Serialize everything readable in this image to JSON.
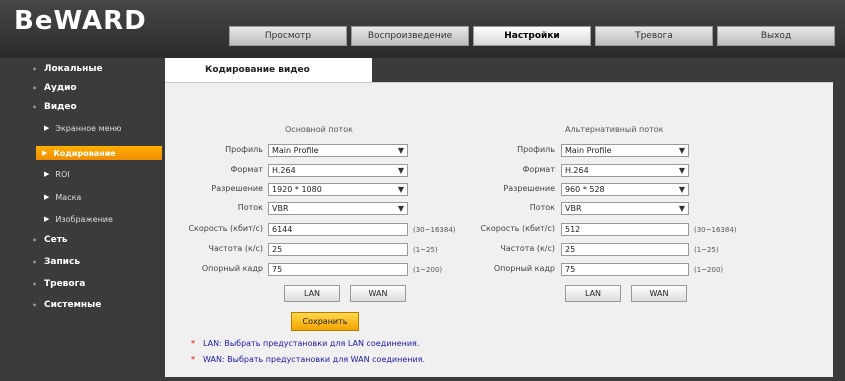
{
  "brand": {
    "logo": "BeWARD"
  },
  "topnav": [
    "Просмотр",
    "Воспроизведение",
    "Настройки",
    "Тревога",
    "Выход"
  ],
  "sidebar": {
    "items": [
      "Локальные",
      "Аудио",
      "Видео",
      "Сеть",
      "Запись",
      "Тревога",
      "Системные"
    ],
    "video_sub": [
      "Экранное меню",
      "Кодирование",
      "ROI",
      "Маска",
      "Изображение"
    ]
  },
  "tab": {
    "title": "Кодирование видео"
  },
  "streams": {
    "main": {
      "title": "Основной поток",
      "profile": "Main Profile",
      "format": "H.264",
      "resolution": "1920 * 1080",
      "bitrate_mode": "VBR",
      "bitrate": "6144",
      "bitrate_range": "(30~16384)",
      "fps": "25",
      "fps_range": "(1~25)",
      "gop": "75",
      "gop_range": "(1~200)"
    },
    "alt": {
      "title": "Альтернативный поток",
      "profile": "Main Profile",
      "format": "H.264",
      "resolution": "960 * 528",
      "bitrate_mode": "VBR",
      "bitrate": "512",
      "bitrate_range": "(30~16384)",
      "fps": "25",
      "fps_range": "(1~25)",
      "gop": "75",
      "gop_range": "(1~200)"
    }
  },
  "labels": {
    "profile": "Профиль",
    "format": "Формат",
    "resolution": "Разрешение",
    "bitrate_mode": "Поток",
    "bitrate": "Скорость (кбит/с)",
    "fps": "Частота (к/с)",
    "gop": "Опорный кадр"
  },
  "buttons": {
    "lan": "LAN",
    "wan": "WAN",
    "save": "Сохранить"
  },
  "notes": [
    "LAN: Выбрать предустановки для LAN соединения.",
    "WAN: Выбрать предустановки для WAN соединения."
  ],
  "icons": {
    "chevron": "chevron-down-icon",
    "bullet": "bullet-icon",
    "arrow": "triangle-right-icon"
  }
}
